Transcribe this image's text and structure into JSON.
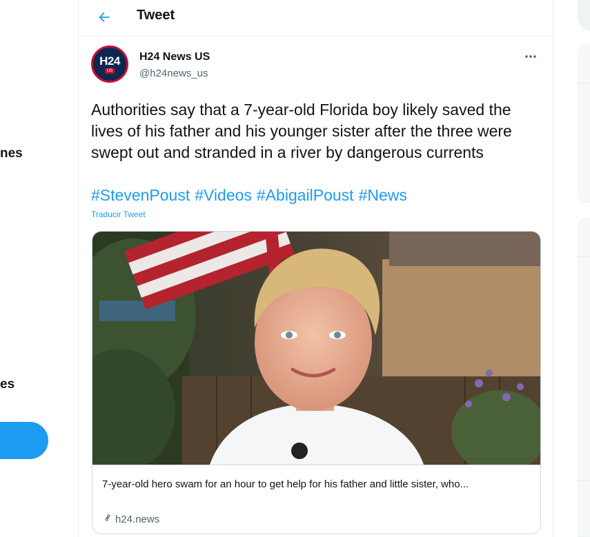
{
  "leftnav": {
    "items": [
      {
        "label": "nes"
      },
      {
        "label": "es"
      }
    ]
  },
  "header": {
    "title": "Tweet",
    "back_icon": "arrow-left-icon"
  },
  "tweet": {
    "author": {
      "name": "H24 News US",
      "handle": "@h24news_us",
      "avatar_text": "H24",
      "avatar_sub": "US"
    },
    "text": "Authorities say that a 7-year-old Florida boy likely saved the lives of his father and his younger sister after the three were swept out and stranded in a river by dangerous currents",
    "hashtags": [
      "#StevenPoust",
      "#Videos",
      "#AbigailPoust",
      "#News"
    ],
    "translate_label": "Traducir Tweet",
    "more_icon": "more-horizontal-icon"
  },
  "card": {
    "title": "7-year-old hero swam for an hour to get help for his father and little sister, who...",
    "domain": "h24.news",
    "link_icon": "link-icon"
  },
  "colors": {
    "accent": "#1d9bf0",
    "text": "#0f1419",
    "muted": "#536471",
    "border": "#cfd9de"
  }
}
